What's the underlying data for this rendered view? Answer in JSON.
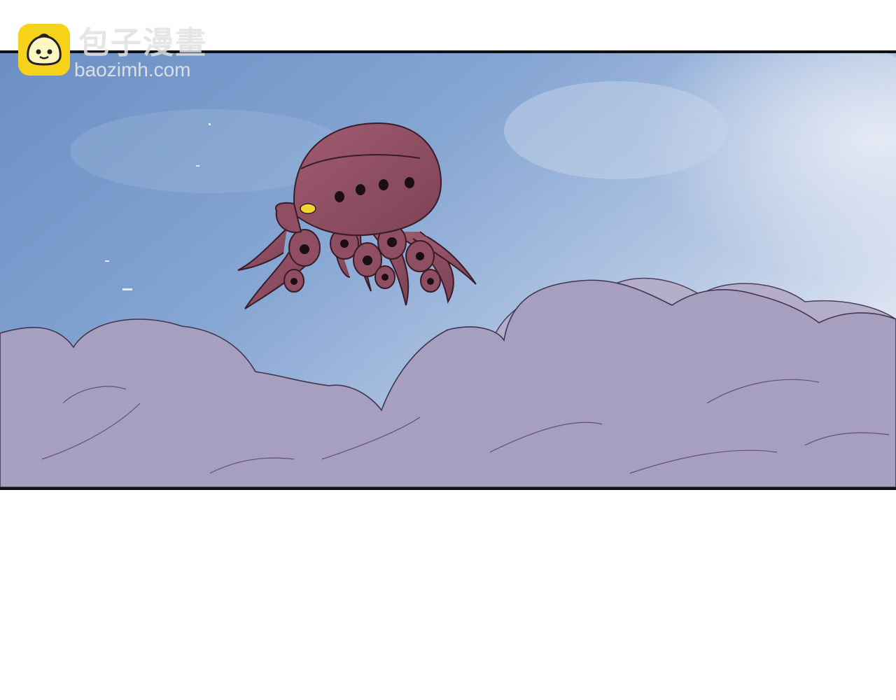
{
  "watermark": {
    "site_name": "包子漫畫",
    "site_url": "baozimh.com",
    "logo_icon": "bun-mascot-icon",
    "logo_color": "#f7d21a"
  },
  "panel": {
    "sky_color": "#7e9cc9",
    "cloud_color": "#a89fbc",
    "octopus_color": "#8f4e62",
    "eye_color": "#f2d62e",
    "border_color": "#111111"
  }
}
